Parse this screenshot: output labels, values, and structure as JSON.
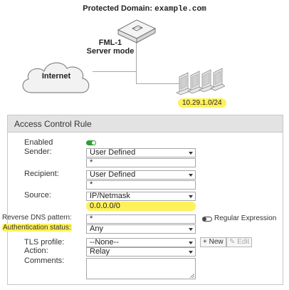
{
  "diagram": {
    "title_prefix": "Protected Domain: ",
    "domain": "example.com",
    "device_name": "FML-1",
    "device_mode": "Server mode",
    "cloud_label": "Internet",
    "subnet": "10.29.1.0/24",
    "highlight_color": "#fff15a"
  },
  "panel": {
    "title": "Access Control Rule",
    "enabled": {
      "label": "Enabled",
      "value": true
    },
    "sender": {
      "label": "Sender:",
      "type": "User Defined",
      "pattern": "*"
    },
    "recipient": {
      "label": "Recipient:",
      "type": "User Defined",
      "pattern": "*"
    },
    "source": {
      "label": "Source:",
      "type": "IP/Netmask",
      "value": "0.0.0.0/0"
    },
    "reverse_dns": {
      "label": "Reverse DNS pattern:",
      "value": "*",
      "regex_label": "Regular Expression",
      "regex_enabled": false
    },
    "auth_status": {
      "label": "Authentication status:",
      "value": "Any"
    },
    "tls_profile": {
      "label": "TLS profile:",
      "value": "--None--",
      "new_label": "+ New",
      "edit_label": "Edit"
    },
    "action": {
      "label": "Action:",
      "value": "Relay"
    },
    "comments": {
      "label": "Comments:",
      "value": ""
    }
  }
}
